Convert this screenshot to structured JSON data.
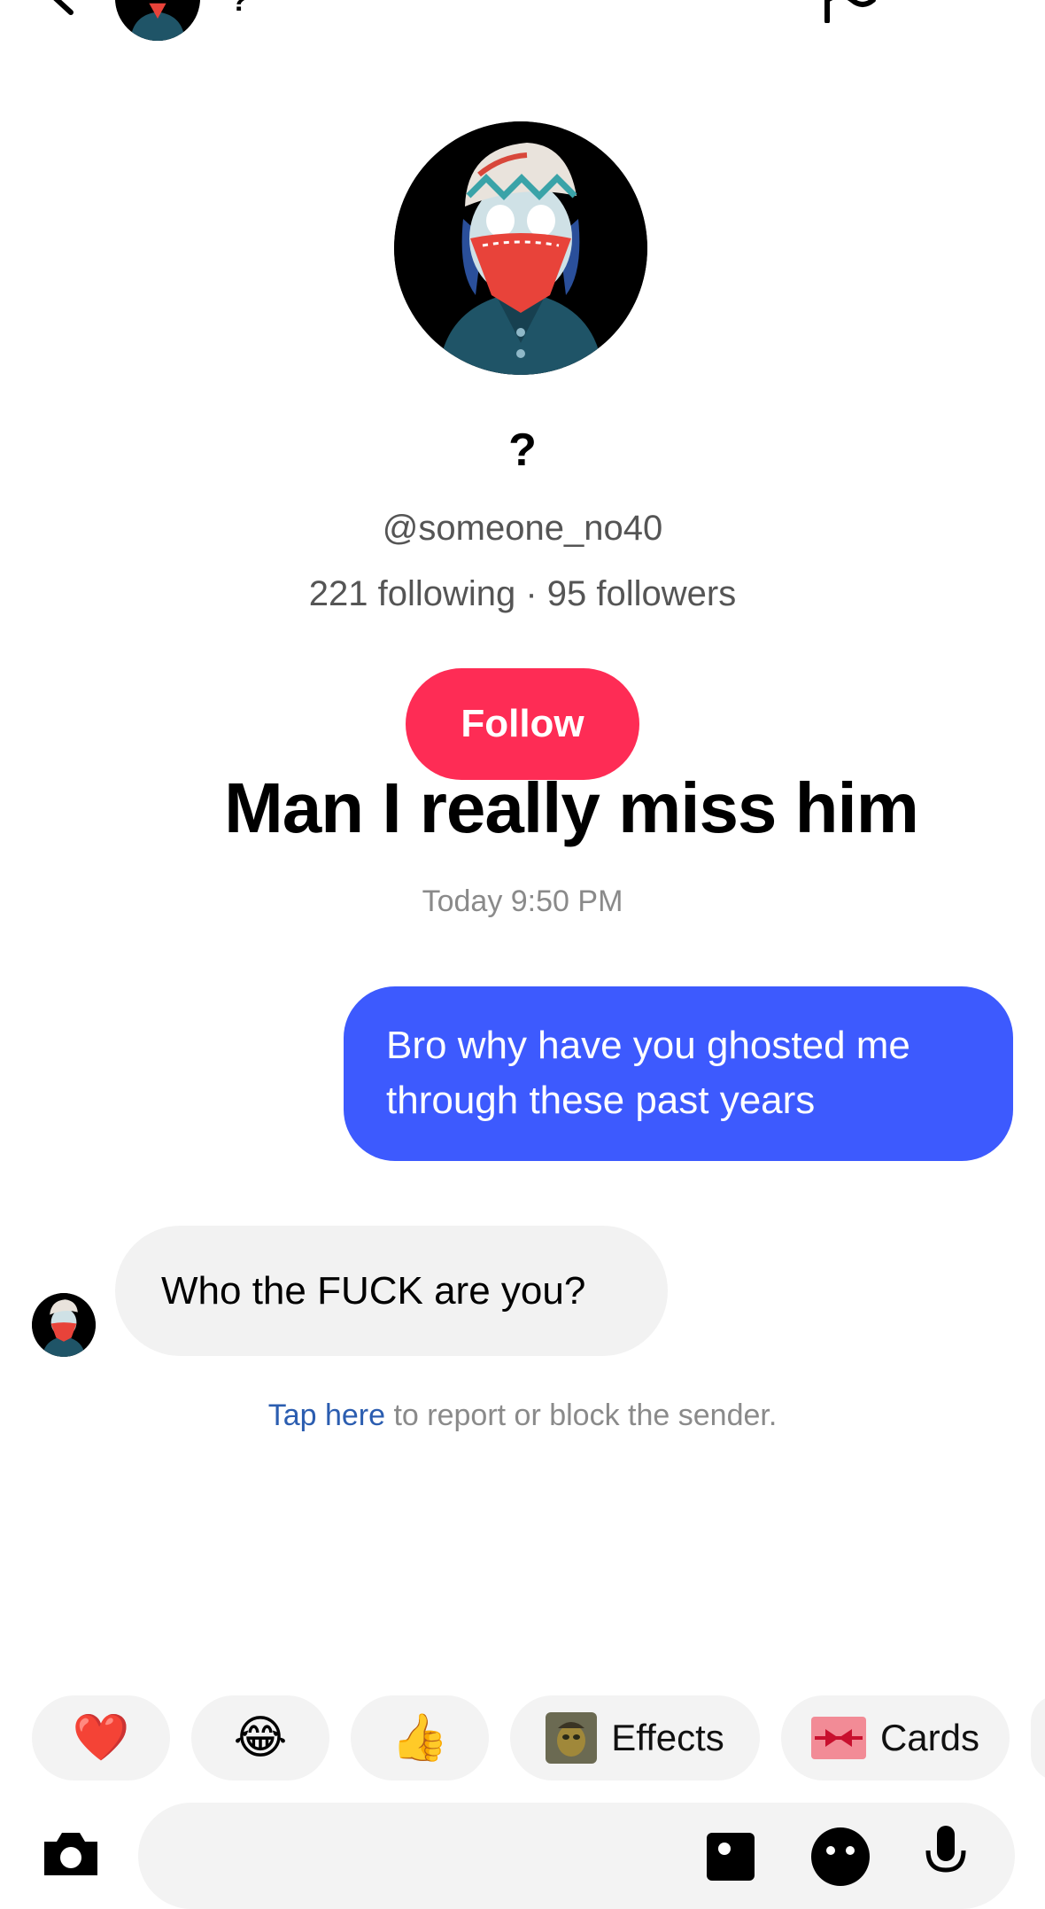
{
  "header": {
    "display_name": "?",
    "back_icon": "chevron-left-icon",
    "flag_icon": "flag-icon",
    "more_icon": "more-icon"
  },
  "profile": {
    "name": "?",
    "handle": "@someone_no40",
    "stats": "221 following · 95 followers",
    "follow_label": "Follow"
  },
  "overlay_caption": "Man I really miss him",
  "conversation": {
    "timestamp": "Today 9:50 PM",
    "sent_message": "Bro why have you ghosted me through these past years",
    "received_message": "Who the FUCK are you?",
    "report_link": "Tap here",
    "report_rest": " to report or block the sender."
  },
  "quick_reactions": {
    "heart": "❤️",
    "laugh": "😂",
    "thumbs_up": "👍",
    "effects_label": "Effects",
    "cards_label": "Cards"
  },
  "composer": {
    "placeholder": ""
  },
  "colors": {
    "follow": "#fe2c55",
    "sent_bubble": "#3d5afe",
    "received_bubble": "#f2f2f2",
    "link": "#2b5db0"
  }
}
